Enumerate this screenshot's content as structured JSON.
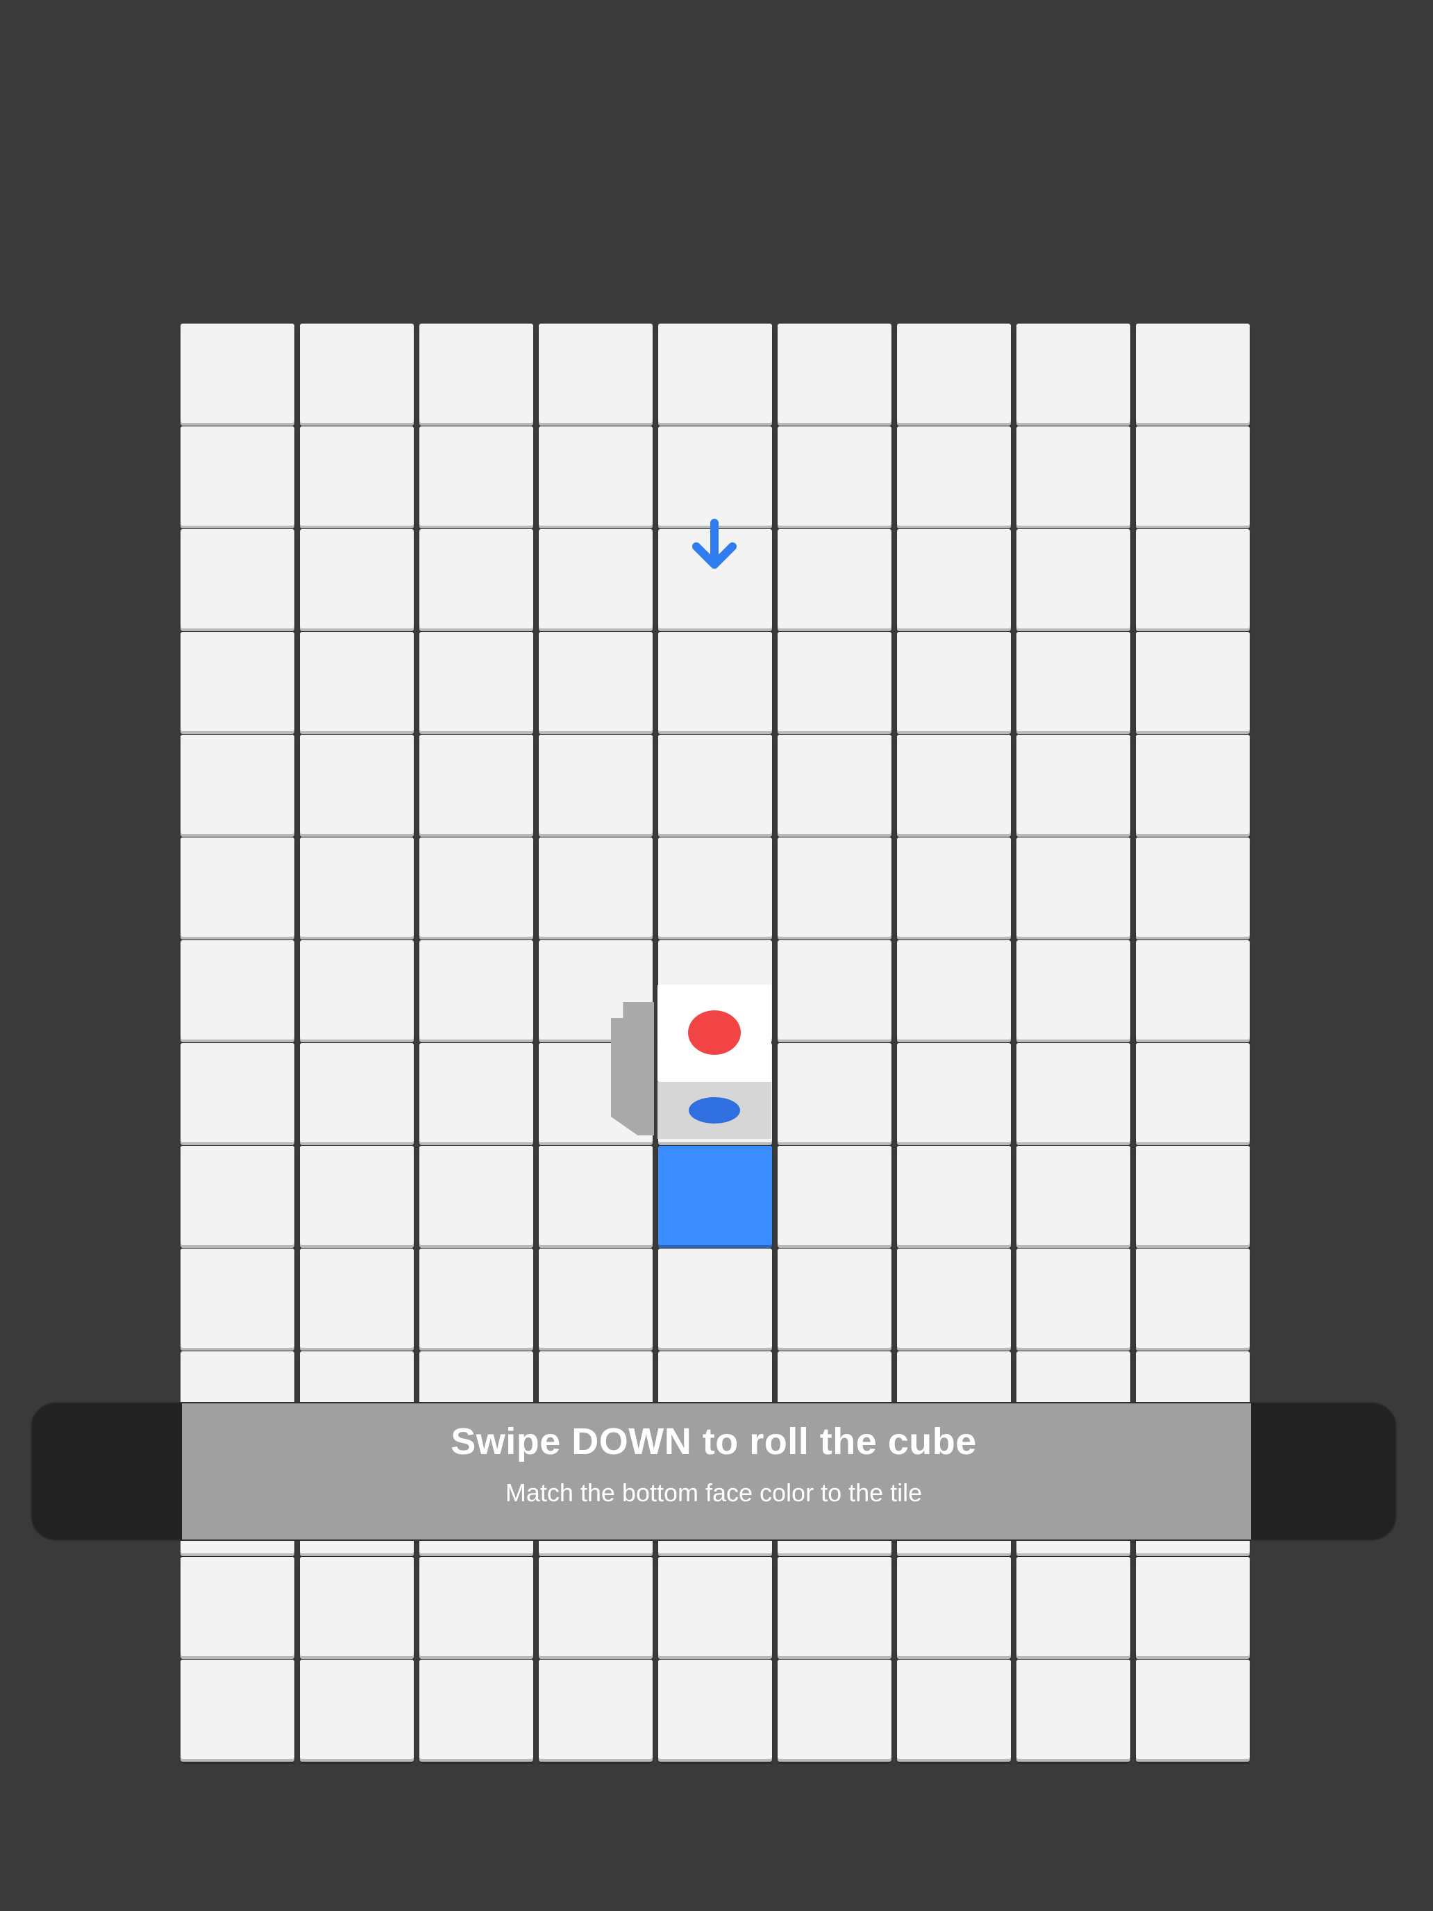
{
  "game": {
    "board": {
      "columns": 9,
      "rows": 14,
      "tile_color": "#f3f3f3",
      "target_tile": {
        "column": 5,
        "row": 9,
        "color": "#3b8cff"
      }
    },
    "direction_indicator": {
      "icon": "arrow-down-icon",
      "direction": "down",
      "color": "#2f7cf0"
    },
    "cube": {
      "column": 5,
      "row": 8,
      "top_face_color": "#ffffff",
      "top_face_dot_color": "#f24444",
      "front_face_dot_color": "#2f6fe0"
    }
  },
  "instructions": {
    "title": "Swipe DOWN to roll the cube",
    "subtitle": "Match the bottom face color to the tile"
  }
}
